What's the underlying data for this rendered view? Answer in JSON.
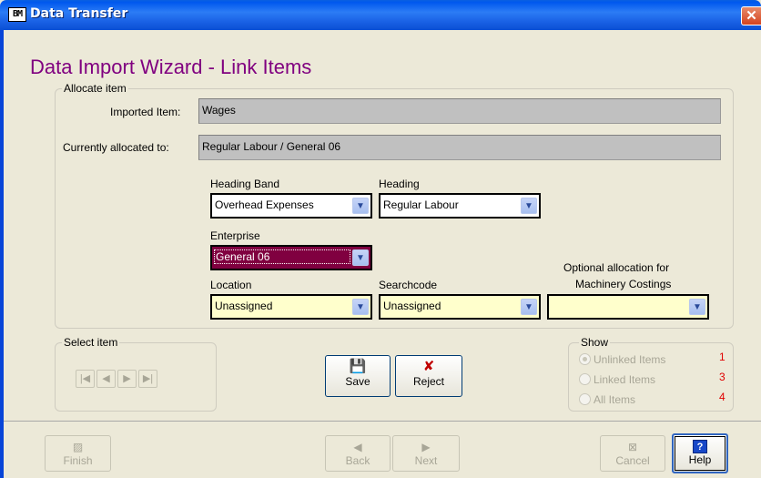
{
  "window": {
    "title": "Data Transfer",
    "icon_text": "BM",
    "close_glyph": "✕"
  },
  "page": {
    "heading": "Data Import Wizard - Link Items"
  },
  "allocate": {
    "group_label": "Allocate item",
    "imported_label": "Imported Item:",
    "imported_value": "Wages",
    "allocated_label": "Currently allocated to:",
    "allocated_value": "Regular Labour / General 06",
    "heading_band_label": "Heading Band",
    "heading_band_value": "Overhead Expenses",
    "heading_label": "Heading",
    "heading_value": "Regular Labour",
    "enterprise_label": "Enterprise",
    "enterprise_value": "General 06",
    "location_label": "Location",
    "location_value": "Unassigned",
    "searchcode_label": "Searchcode",
    "searchcode_value": "Unassigned",
    "machinery_label_1": "Optional allocation for",
    "machinery_label_2": "Machinery Costings",
    "machinery_value": ""
  },
  "select": {
    "group_label": "Select item",
    "buttons": [
      "|◀",
      "◀",
      "▶",
      "▶|"
    ]
  },
  "actions": {
    "save_label": "Save",
    "reject_label": "Reject"
  },
  "show": {
    "group_label": "Show",
    "options": [
      {
        "label": "Unlinked Items",
        "count": "1",
        "selected": true
      },
      {
        "label": "Linked Items",
        "count": "3",
        "selected": false
      },
      {
        "label": "All Items",
        "count": "4",
        "selected": false
      }
    ]
  },
  "footer": {
    "finish_label": "Finish",
    "back_label": "Back",
    "next_label": "Next",
    "cancel_label": "Cancel",
    "help_label": "Help"
  },
  "colors": {
    "heading": "#800080",
    "enterprise_selected_bg": "#800040",
    "optional_field_bg": "#ffffcc",
    "count_red": "#e00000"
  }
}
